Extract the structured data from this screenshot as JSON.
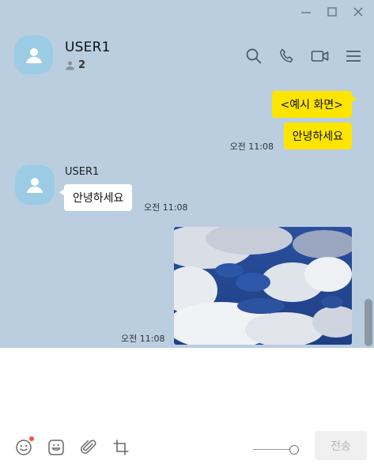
{
  "header": {
    "title": "USER1",
    "member_count": "2"
  },
  "messages": [
    {
      "id": "m1",
      "text": "<예시 화면>",
      "sender": "me"
    },
    {
      "id": "m2",
      "text": "안녕하세요",
      "sender": "me",
      "time": "오전 11:08"
    },
    {
      "id": "m3",
      "sender_name": "USER1",
      "text": "안녕하세요",
      "sender": "other",
      "time": "오전 11:08"
    },
    {
      "id": "m4",
      "type": "image",
      "sender": "me",
      "time": "오전 11:08"
    }
  ],
  "composer": {
    "value": "",
    "send_label": "전송"
  },
  "icons": {
    "window": [
      "minimize-icon",
      "maximize-icon",
      "close-icon"
    ],
    "header": [
      "search-icon",
      "phone-icon",
      "video-call-icon",
      "menu-icon"
    ],
    "tools": [
      "emoji-icon",
      "emoticon-icon",
      "attach-icon",
      "crop-icon"
    ]
  },
  "colors": {
    "chat_background": "#bacee0",
    "my_bubble": "#fee500",
    "other_bubble": "#ffffff",
    "avatar": "#9ccbe5",
    "badge_dot": "#ff4d3d"
  }
}
